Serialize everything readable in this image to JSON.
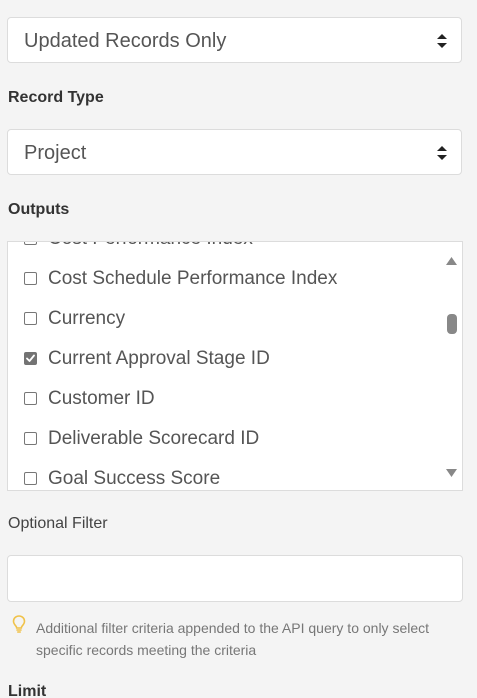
{
  "mode_select": {
    "value": "Updated Records Only"
  },
  "record_type": {
    "label": "Record Type",
    "value": "Project"
  },
  "outputs": {
    "label": "Outputs",
    "items": [
      {
        "label": "Cost Performance Index",
        "checked": false
      },
      {
        "label": "Cost Schedule Performance Index",
        "checked": false
      },
      {
        "label": "Currency",
        "checked": false
      },
      {
        "label": "Current Approval Stage ID",
        "checked": true
      },
      {
        "label": "Customer ID",
        "checked": false
      },
      {
        "label": "Deliverable Scorecard ID",
        "checked": false
      },
      {
        "label": "Goal Success Score",
        "checked": false
      }
    ]
  },
  "optional_filter": {
    "label": "Optional Filter",
    "value": "",
    "hint": "Additional filter criteria appended to the API query to only select specific records meeting the criteria"
  },
  "limit": {
    "label": "Limit"
  },
  "icons": {
    "select_caret": "sort-caret-icon",
    "hint": "lightbulb-icon",
    "scroll_up": "scroll-up-arrow-icon",
    "scroll_down": "scroll-down-arrow-icon",
    "checkbox_checked": "checkmark-icon"
  },
  "colors": {
    "hint_icon": "#f0c24a",
    "checkbox_checked": "#737373"
  }
}
